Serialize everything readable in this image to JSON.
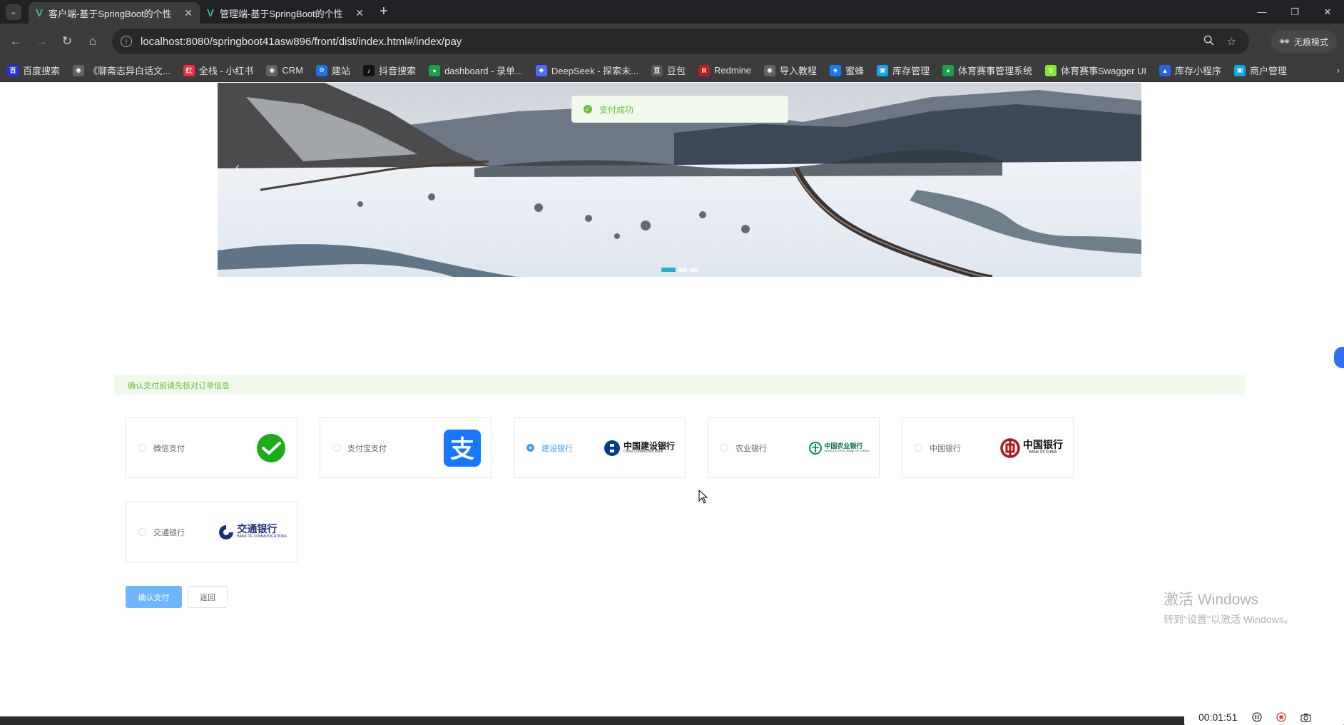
{
  "browser": {
    "tabs": [
      {
        "title": "客户端-基于SpringBoot的个性",
        "active": true
      },
      {
        "title": "管理端-基于SpringBoot的个性",
        "active": false
      }
    ],
    "url": "localhost:8080/springboot41asw896/front/dist/index.html#/index/pay",
    "incognito_label": "无痕模式",
    "bookmarks": [
      {
        "label": "百度搜索",
        "icon": "baidu-icon",
        "color": "#2932e1"
      },
      {
        "label": "《聊斋志异白话文...",
        "icon": "globe-icon",
        "color": "#5f6368"
      },
      {
        "label": "全栈 - 小红书",
        "icon": "xiaohongshu-icon",
        "color": "#ff2442"
      },
      {
        "label": "CRM",
        "icon": "globe-icon",
        "color": "#5f6368"
      },
      {
        "label": "建站",
        "icon": "gear-icon",
        "color": "#1a73e8"
      },
      {
        "label": "抖音搜索",
        "icon": "tiktok-icon",
        "color": "#111111"
      },
      {
        "label": "dashboard - 录单...",
        "icon": "leaf-icon",
        "color": "#16a34a"
      },
      {
        "label": "DeepSeek - 探索未...",
        "icon": "deepseek-icon",
        "color": "#4d6bfe"
      },
      {
        "label": "豆包",
        "icon": "doubao-icon",
        "color": "#555555"
      },
      {
        "label": "Redmine",
        "icon": "redmine-icon",
        "color": "#b32024"
      },
      {
        "label": "导入教程",
        "icon": "globe-icon",
        "color": "#5f6368"
      },
      {
        "label": "蜜蜂",
        "icon": "shield-icon",
        "color": "#1677ff"
      },
      {
        "label": "库存管理",
        "icon": "app-icon",
        "color": "#0ea5e9"
      },
      {
        "label": "体育赛事管理系统",
        "icon": "leaf-icon",
        "color": "#16a34a"
      },
      {
        "label": "体育赛事Swagger UI",
        "icon": "swagger-icon",
        "color": "#85ea2d"
      },
      {
        "label": "库存小程序",
        "icon": "triangle-icon",
        "color": "#2563eb"
      },
      {
        "label": "商户管理",
        "icon": "app-icon",
        "color": "#0ea5e9"
      }
    ]
  },
  "page": {
    "toast": "支付成功",
    "notice": "确认支付前请先核对订单信息",
    "payment_options": [
      {
        "label": "微信支付",
        "logo": "wechat-pay-logo",
        "selected": false
      },
      {
        "label": "支付宝支付",
        "logo": "alipay-logo",
        "selected": false
      },
      {
        "label": "建设银行",
        "logo": "ccb-logo",
        "logo_text": "中国建设银行",
        "logo_sub": "China Construction Bank",
        "selected": true
      },
      {
        "label": "农业银行",
        "logo": "abc-logo",
        "logo_text": "中国农业银行",
        "logo_sub": "AGRICULTURAL BANK OF CHINA",
        "selected": false
      },
      {
        "label": "中国银行",
        "logo": "boc-logo",
        "logo_text": "中国银行",
        "logo_sub": "BANK OF CHINA",
        "selected": false
      },
      {
        "label": "交通银行",
        "logo": "bocom-logo",
        "logo_text": "交通银行",
        "logo_sub": "BANK OF COMMUNICATIONS",
        "selected": false
      }
    ],
    "confirm_label": "确认支付",
    "back_label": "返回",
    "carousel": {
      "slides": 3,
      "active_index": 0
    }
  },
  "overlay": {
    "watermark_line1": "激活 Windows",
    "watermark_line2": "转到\"设置\"以激活 Windows。",
    "recorder_time": "00:01:51"
  }
}
